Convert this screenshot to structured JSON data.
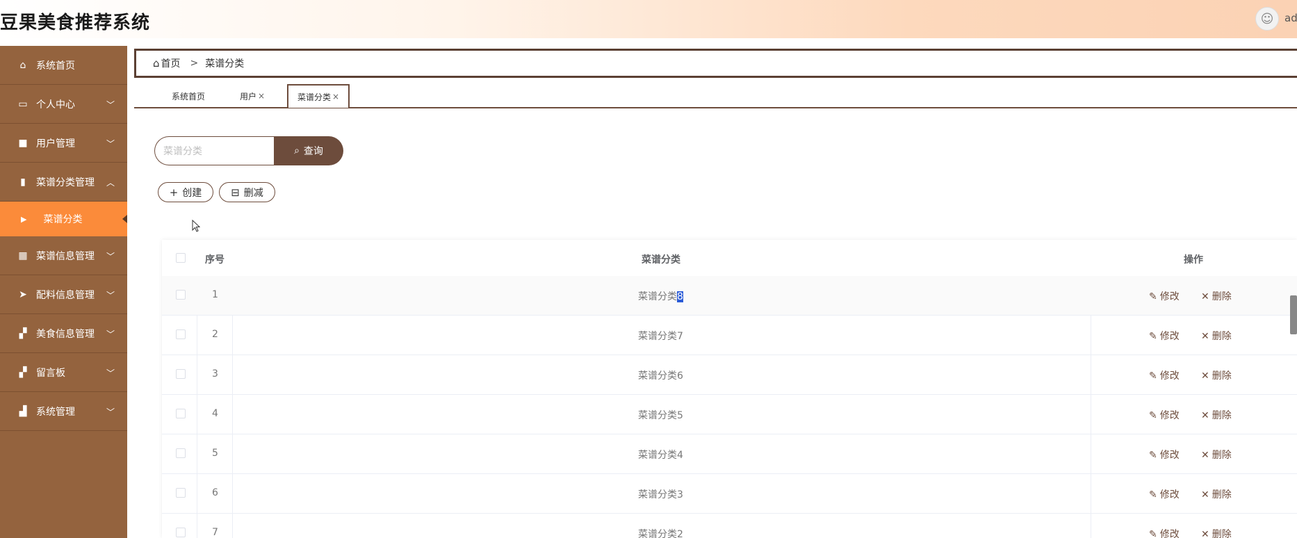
{
  "header": {
    "title": "豆果美食推荐系统",
    "user": "adi"
  },
  "sidebar": {
    "items": [
      {
        "label": "系统首页",
        "icon": "home-icon",
        "glyph": "⌂",
        "arrow": ""
      },
      {
        "label": "个人中心",
        "icon": "wallet-icon",
        "glyph": "▭",
        "arrow": "﹀"
      },
      {
        "label": "用户管理",
        "icon": "briefcase-icon",
        "glyph": "■",
        "arrow": "﹀"
      },
      {
        "label": "菜谱分类管理",
        "icon": "clipboard-icon",
        "glyph": "▮",
        "arrow": "︿"
      },
      {
        "label": "菜谱信息管理",
        "icon": "grid-icon",
        "glyph": "▦",
        "arrow": "﹀"
      },
      {
        "label": "配料信息管理",
        "icon": "send-icon",
        "glyph": "➤",
        "arrow": "﹀"
      },
      {
        "label": "美食信息管理",
        "icon": "apps-icon",
        "glyph": "▞",
        "arrow": "﹀"
      },
      {
        "label": "留言板",
        "icon": "apps-icon",
        "glyph": "▞",
        "arrow": "﹀"
      },
      {
        "label": "系统管理",
        "icon": "bar-chart-icon",
        "glyph": "▟",
        "arrow": "﹀"
      }
    ],
    "sub_item": "菜谱分类"
  },
  "breadcrumb": {
    "home": "首页",
    "sep": ">",
    "current": "菜谱分类"
  },
  "tabs": [
    {
      "label": "系统首页",
      "close": ""
    },
    {
      "label": "用户",
      "close": "×"
    },
    {
      "label": "菜谱分类",
      "close": "×"
    }
  ],
  "search": {
    "placeholder": "菜谱分类",
    "button": "查询"
  },
  "actions": {
    "create": "创建",
    "delete": "删减"
  },
  "table": {
    "headers": {
      "index": "序号",
      "category": "菜谱分类",
      "ops": "操作"
    },
    "rows": [
      {
        "index": "1",
        "name_prefix": "菜谱分类",
        "name_sel": "8"
      },
      {
        "index": "2",
        "name": "菜谱分类7"
      },
      {
        "index": "3",
        "name": "菜谱分类6"
      },
      {
        "index": "4",
        "name": "菜谱分类5"
      },
      {
        "index": "5",
        "name": "菜谱分类4"
      },
      {
        "index": "6",
        "name": "菜谱分类3"
      },
      {
        "index": "7",
        "name": "菜谱分类2"
      }
    ],
    "edit": "修改",
    "remove": "删除"
  },
  "colors": {
    "brown": "#6d4c3c",
    "sidebar": "#94633e",
    "active": "#fb8b3a"
  }
}
